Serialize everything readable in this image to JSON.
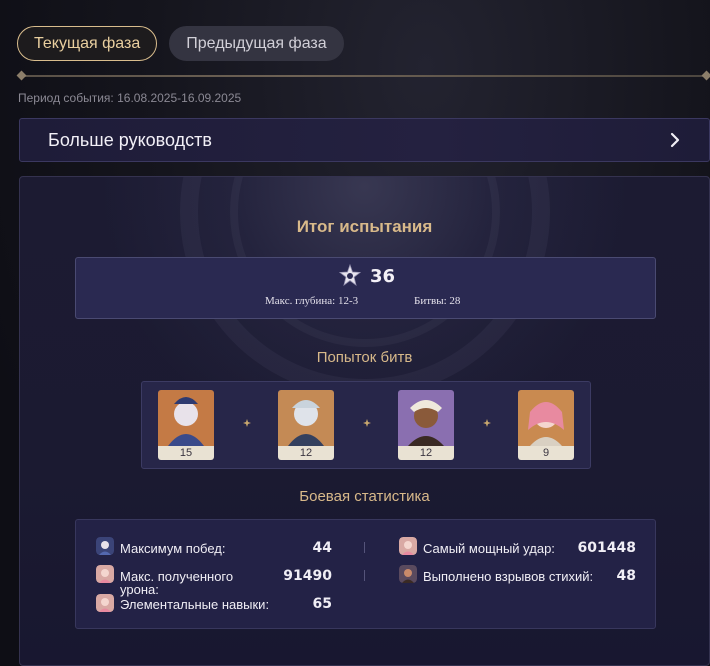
{
  "tabs": [
    {
      "label": "Текущая фаза",
      "active": true
    },
    {
      "label": "Предыдущая фаза",
      "active": false
    }
  ],
  "period": "Период события: 16.08.2025-16.09.2025",
  "guides": {
    "label": "Больше руководств",
    "icon": "chevron-right-icon"
  },
  "result": {
    "title": "Итог испытания",
    "stars": "36",
    "max_depth": "Макс. глубина: 12-3",
    "battles": "Битвы: 28"
  },
  "attempts": {
    "title": "Попыток битв",
    "characters": [
      {
        "count": "15",
        "icon": "character-portrait-icon",
        "color": "#c47a45"
      },
      {
        "count": "12",
        "icon": "character-portrait-icon",
        "color": "#c48a55"
      },
      {
        "count": "12",
        "icon": "character-portrait-icon",
        "color": "#8a6fb0"
      },
      {
        "count": "9",
        "icon": "character-portrait-icon",
        "color": "#c98a50"
      }
    ]
  },
  "stats": {
    "title": "Боевая статистика",
    "items": [
      {
        "label": "Максимум побед:",
        "value": "44",
        "icon": "character-mini-icon"
      },
      {
        "label": "Самый мощный удар:",
        "value": "601448",
        "icon": "character-mini-icon"
      },
      {
        "label_line1": "Макс. полученного",
        "label_line2": "урона:",
        "value": "91490",
        "icon": "character-mini-icon"
      },
      {
        "label": "Выполнено взрывов стихий:",
        "value": "48",
        "icon": "character-mini-icon"
      },
      {
        "label": "Элементальные навыки:",
        "value": "65",
        "icon": "character-mini-icon"
      }
    ]
  },
  "colors": {
    "accent_gold": "#d8b98a",
    "card_bg": "#1c1b32",
    "panel_bg": "#2a2951"
  }
}
